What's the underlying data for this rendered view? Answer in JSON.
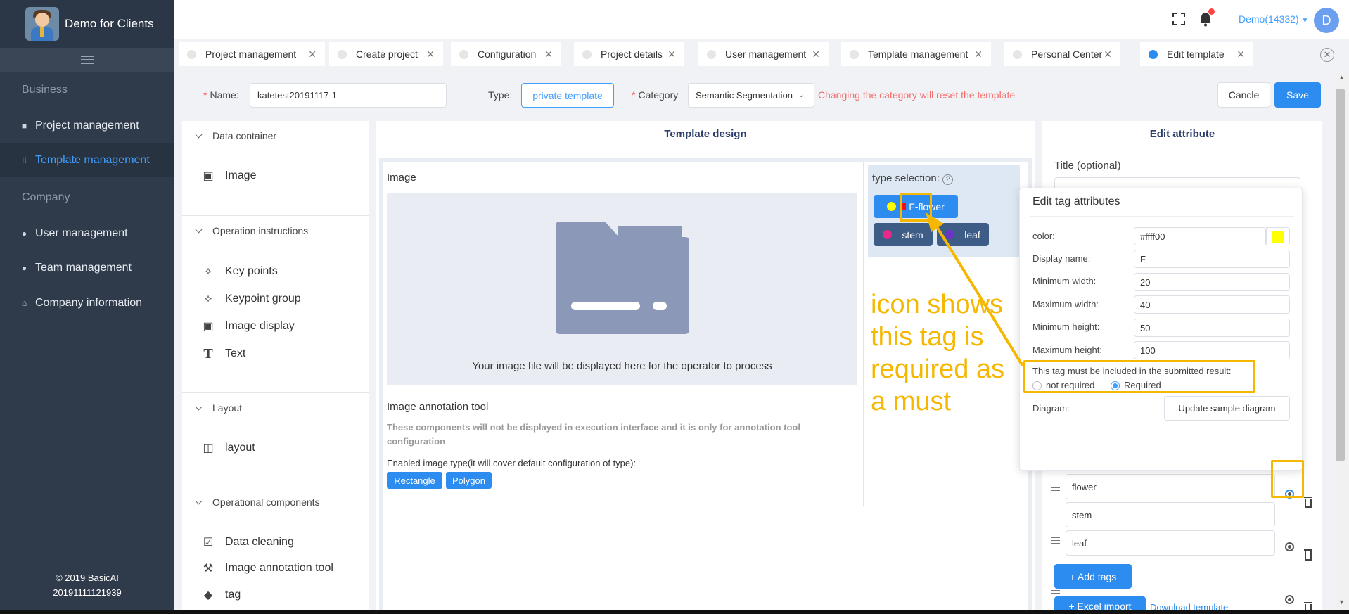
{
  "brand": {
    "title": "Demo for Clients"
  },
  "sidebar": {
    "sections": {
      "business": "Business",
      "company": "Company"
    },
    "items": [
      {
        "label": "Project management",
        "icon": "book-icon"
      },
      {
        "label": "Template management",
        "icon": "grid-icon",
        "active": true
      },
      {
        "label": "User management",
        "icon": "users-icon"
      },
      {
        "label": "Team management",
        "icon": "team-icon"
      },
      {
        "label": "Company information",
        "icon": "home-icon"
      }
    ],
    "footer": {
      "copyright": "© 2019 BasicAI",
      "build": "20191111121939"
    }
  },
  "header": {
    "account": "Demo(14332)",
    "avatar_letter": "D"
  },
  "tabs": [
    {
      "label": "Project management"
    },
    {
      "label": "Create project"
    },
    {
      "label": "Configuration"
    },
    {
      "label": "Project details"
    },
    {
      "label": "User management"
    },
    {
      "label": "Template management"
    },
    {
      "label": "Personal Center"
    },
    {
      "label": "Edit template",
      "active": true
    }
  ],
  "form": {
    "name_label": "Name:",
    "name_value": "katetest20191117-1",
    "type_label": "Type:",
    "type_value": "private template",
    "category_label": "Category",
    "category_value": "Semantic Segmentation",
    "category_warning": "Changing the category will reset the template",
    "cancel_label": "Cancle",
    "save_label": "Save"
  },
  "components": {
    "data_container": {
      "title": "Data container",
      "items": [
        "Image"
      ]
    },
    "operation_instructions": {
      "title": "Operation instructions",
      "items": [
        "Key points",
        "Keypoint group",
        "Image display",
        "Text"
      ]
    },
    "layout": {
      "title": "Layout",
      "items": [
        "layout"
      ]
    },
    "operational_components": {
      "title": "Operational components",
      "items": [
        "Data cleaning",
        "Image annotation tool",
        "tag"
      ]
    }
  },
  "design": {
    "title": "Template design",
    "image_title": "Image",
    "image_placeholder": "Your image file will be displayed here for the operator to process",
    "tool_title": "Image annotation tool",
    "tool_note": "These components will not be displayed in execution interface and it is only for annotation tool configuration",
    "enabled_types_label": "Enabled image type(it will cover default configuration of type):",
    "enabled_types": [
      "Rectangle",
      "Polygon"
    ],
    "type_selection_label": "type selection:",
    "tags": [
      {
        "label": "F-flower",
        "color": "#ffff00"
      },
      {
        "label": "stem",
        "color": "#e8288a"
      },
      {
        "label": "leaf",
        "color": "#6a34c9"
      }
    ]
  },
  "attributes": {
    "title": "Edit attribute",
    "title_field_label": "Title (optional)",
    "tags": [
      "flower",
      "stem",
      "leaf"
    ],
    "add_tags_label": "+  Add tags",
    "excel_import_label": "+  Excel import",
    "download_template_label": "Download template"
  },
  "popup": {
    "title": "Edit tag attributes",
    "color_label": "color:",
    "color_value": "#ffff00",
    "display_name_label": "Display name:",
    "display_name_value": "F",
    "min_width_label": "Minimum width:",
    "min_width_value": "20",
    "max_width_label": "Maximum width:",
    "max_width_value": "40",
    "min_height_label": "Minimum height:",
    "min_height_value": "50",
    "max_height_label": "Maximum height:",
    "max_height_value": "100",
    "required_question": "This tag must be included in the submitted result:",
    "not_required_label": "not required",
    "required_label": "Required",
    "diagram_label": "Diagram:",
    "update_diagram_label": "Update sample diagram"
  },
  "annotation": {
    "text": "icon shows this tag is required as a must",
    "color": "#f5b700"
  }
}
